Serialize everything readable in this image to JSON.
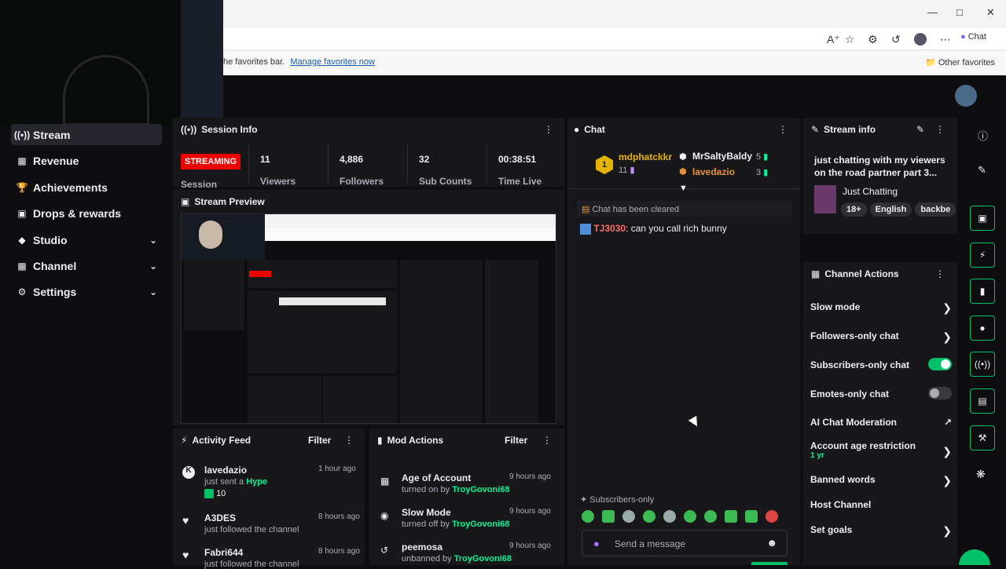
{
  "browser": {
    "fav_text": "he favorites bar.",
    "fav_link": "Manage favorites now",
    "other_favorites": "Other favorites",
    "chat_label": "Chat",
    "icons": [
      "read-aloud-icon",
      "favorite-star-icon",
      "extensions-icon",
      "history-icon",
      "profile-icon",
      "more-icon",
      "copilot-icon"
    ]
  },
  "nav": {
    "items": [
      {
        "label": "Stream",
        "icon": "broadcast-icon"
      },
      {
        "label": "Revenue",
        "icon": "revenue-icon"
      },
      {
        "label": "Achievements",
        "icon": "trophy-icon"
      },
      {
        "label": "Drops & rewards",
        "icon": "gift-icon"
      },
      {
        "label": "Studio",
        "icon": "studio-icon"
      },
      {
        "label": "Channel",
        "icon": "channel-icon"
      },
      {
        "label": "Settings",
        "icon": "gear-icon"
      }
    ]
  },
  "session": {
    "title": "Session Info",
    "badge": "STREAMING",
    "session_label": "Session",
    "stats": [
      {
        "value": "11",
        "label": "Viewers"
      },
      {
        "value": "4,886",
        "label": "Followers"
      },
      {
        "value": "32",
        "label": "Sub Counts"
      },
      {
        "value": "00:38:51",
        "label": "Time Live"
      }
    ]
  },
  "preview": {
    "title": "Stream Preview"
  },
  "activity": {
    "title": "Activity Feed",
    "filter": "Filter",
    "items": [
      {
        "name": "lavedazio",
        "sub": "just sent a",
        "extra": "Hype",
        "amount": "10",
        "time": "1 hour ago"
      },
      {
        "name": "A3DES",
        "sub": "just followed the channel",
        "time": "8 hours ago"
      },
      {
        "name": "Fabri644",
        "sub": "just followed the channel",
        "time": "8 hours ago"
      }
    ]
  },
  "mod": {
    "title": "Mod Actions",
    "filter": "Filter",
    "items": [
      {
        "name": "Age of Account",
        "action": "turned on by",
        "by": "TroyGovoni68",
        "time": "9 hours ago"
      },
      {
        "name": "Slow Mode",
        "action": "turned off by",
        "by": "TroyGovoni68",
        "time": "9 hours ago"
      },
      {
        "name": "peemosa",
        "action": "unbanned by",
        "by": "TroyGovoni68",
        "time": "9 hours ago"
      }
    ]
  },
  "chat": {
    "title": "Chat",
    "leaders": [
      {
        "name": "mdphatckkr",
        "count": "11"
      },
      {
        "name": "MrSaltyBaldy",
        "count": "5"
      },
      {
        "name": "lavedazio",
        "count": "3"
      }
    ],
    "cleared": "Chat has been cleared",
    "message_user": "TJ3030",
    "message_text": ": can you call rich bunny",
    "mode": "Subscribers-only",
    "placeholder": "Send a message"
  },
  "stream_info": {
    "title": "Stream info",
    "stream_title": "just chatting with my viewers on the road partner part 3...",
    "category": "Just Chatting",
    "tags": [
      "18+",
      "English",
      "backbe"
    ]
  },
  "channel_actions": {
    "title": "Channel Actions",
    "items": [
      {
        "label": "Slow mode",
        "kind": "arrow"
      },
      {
        "label": "Followers-only chat",
        "kind": "arrow"
      },
      {
        "label": "Subscribers-only chat",
        "kind": "toggle",
        "on": true
      },
      {
        "label": "Emotes-only chat",
        "kind": "toggle",
        "on": false
      },
      {
        "label": "AI Chat Moderation",
        "kind": "external"
      },
      {
        "label": "Account age restriction",
        "sub": "1 yr",
        "kind": "arrow"
      },
      {
        "label": "Banned words",
        "kind": "arrow"
      },
      {
        "label": "Host Channel",
        "kind": "none"
      },
      {
        "label": "Set goals",
        "kind": "arrow"
      }
    ]
  },
  "colors": {
    "accent": "#00f593",
    "live": "#eb0400",
    "panel": "#18181b",
    "bg": "#0e0e10"
  }
}
